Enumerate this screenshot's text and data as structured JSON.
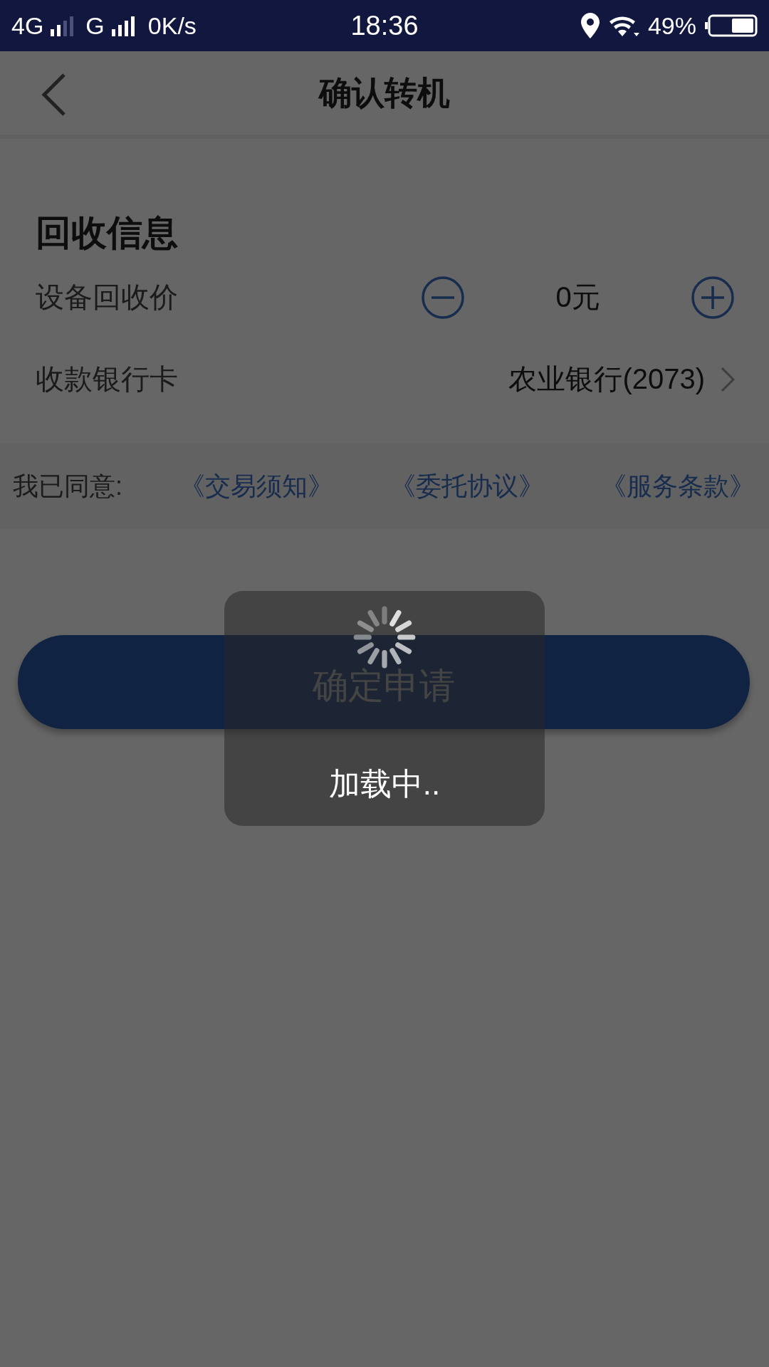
{
  "status_bar": {
    "network_1": "4G",
    "network_2": "G",
    "speed": "0K/s",
    "time": "18:36",
    "battery": "49%"
  },
  "nav": {
    "title": "确认转机"
  },
  "section": {
    "title": "回收信息",
    "price": {
      "label": "设备回收价",
      "value": "0元"
    },
    "bank": {
      "label": "收款银行卡",
      "value": "农业银行(2073)"
    }
  },
  "agreement": {
    "label": "我已同意:",
    "links": [
      "《交易须知》",
      "《委托协议》",
      "《服务条款》"
    ]
  },
  "submit_button": {
    "label": "确定申请"
  },
  "loading": {
    "text": "加载中.."
  }
}
